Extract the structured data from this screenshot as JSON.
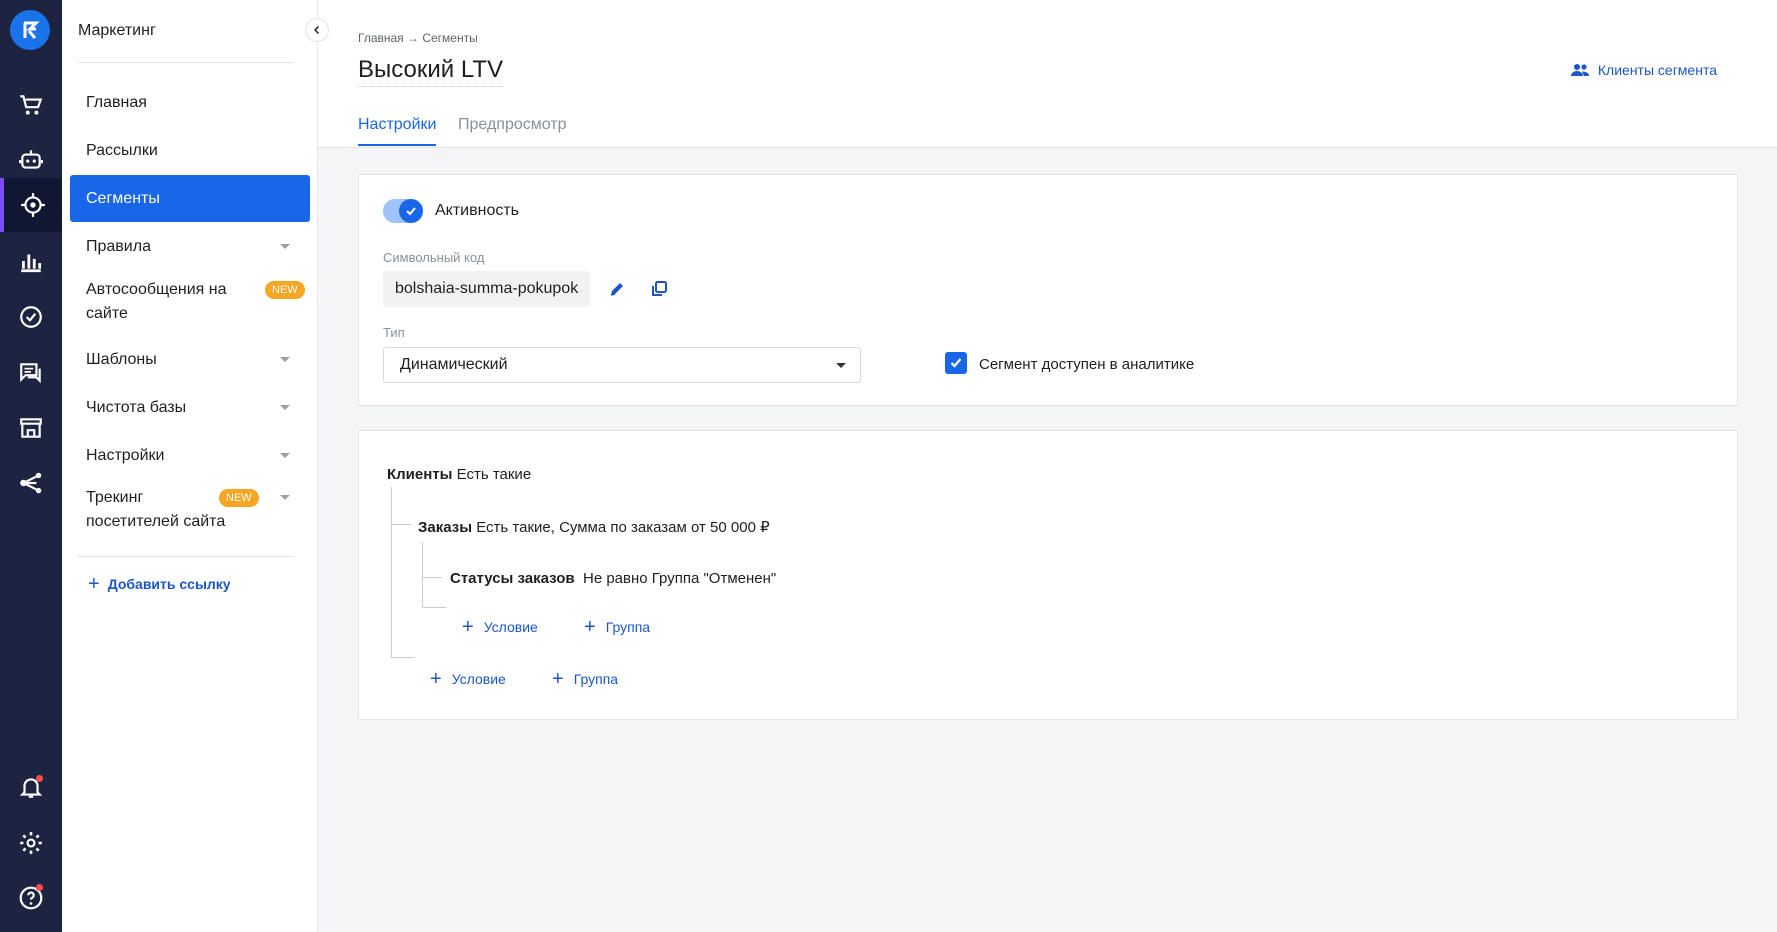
{
  "rail": {
    "colors": {
      "background": "#1c2442",
      "active_accent": "#7c4dff",
      "logo": "#1a73e8"
    },
    "icons": [
      "cart-icon",
      "bot-icon",
      "target-icon",
      "analytics-icon",
      "check-circle-icon",
      "chat-icon",
      "store-icon",
      "share-icon"
    ],
    "bottom_icons": [
      "bell-icon",
      "gear-icon",
      "help-icon"
    ]
  },
  "sidebar": {
    "title": "Маркетинг",
    "items": [
      {
        "label": "Главная"
      },
      {
        "label": "Рассылки"
      },
      {
        "label": "Сегменты"
      },
      {
        "label": "Правила"
      },
      {
        "label": "Автосообщения на сайте",
        "badge": "NEW"
      },
      {
        "label": "Шаблоны"
      },
      {
        "label": "Чистота базы"
      },
      {
        "label": "Настройки"
      },
      {
        "label": "Трекинг посетителей сайта",
        "badge": "NEW"
      }
    ],
    "add_link": "Добавить ссылку"
  },
  "header": {
    "breadcrumb": "Главная → Сегменты",
    "title": "Высокий LTV",
    "clients_link": "Клиенты сегмента",
    "tabs": [
      {
        "label": "Настройки"
      },
      {
        "label": "Предпросмотр"
      }
    ]
  },
  "settings": {
    "activity_label": "Активность",
    "code_label": "Символьный код",
    "code_value": "bolshaia-summa-pokupok",
    "type_label": "Тип",
    "type_value": "Динамический",
    "analytics_label": "Сегмент доступен в аналитике"
  },
  "conditions": {
    "root_name": "Клиенты",
    "root_text": "Есть такие",
    "orders_name": "Заказы",
    "orders_text": "Есть такие, Сумма по заказам от 50 000 ₽",
    "status_name": "Статусы заказов",
    "status_text": "Не равно Группа \"Отменен\"",
    "add_condition": "Условие",
    "add_group": "Группа"
  }
}
